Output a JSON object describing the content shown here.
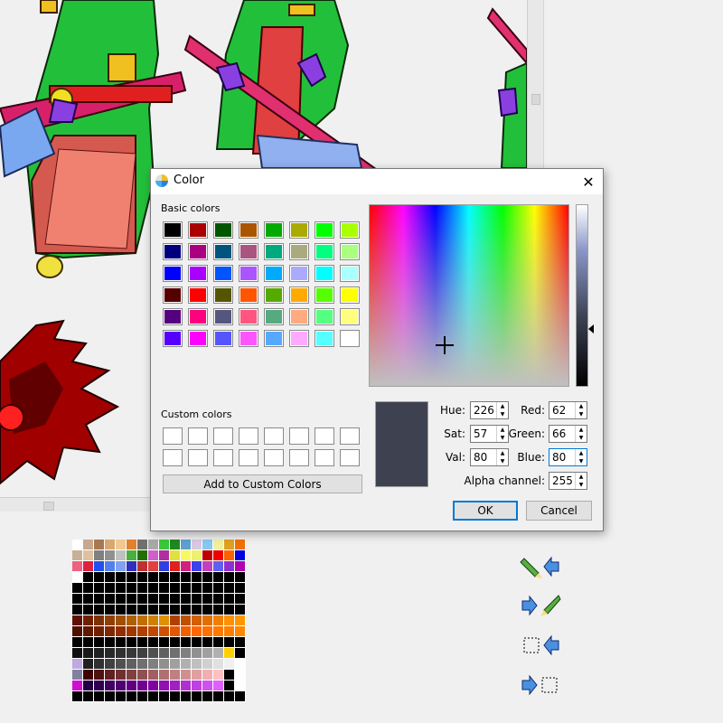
{
  "dialog": {
    "title": "Color",
    "close_glyph": "✕",
    "basic_colors_label": "Basic colors",
    "custom_colors_label": "Custom colors",
    "add_custom_label": "Add to Custom Colors",
    "ok_label": "OK",
    "cancel_label": "Cancel",
    "basic_colors": [
      "#000000",
      "#aa0000",
      "#005500",
      "#aa5500",
      "#00aa00",
      "#aaaa00",
      "#00ff00",
      "#aaff00",
      "#00007f",
      "#aa007f",
      "#00557f",
      "#aa557f",
      "#00aa7f",
      "#aaaa7f",
      "#00ff7f",
      "#aaff7f",
      "#0000ff",
      "#aa00ff",
      "#0055ff",
      "#aa55ff",
      "#00aaff",
      "#aaaaff",
      "#00ffff",
      "#aaffff",
      "#550000",
      "#ff0000",
      "#555500",
      "#ff5500",
      "#55aa00",
      "#ffaa00",
      "#55ff00",
      "#ffff00",
      "#55007f",
      "#ff007f",
      "#55557f",
      "#ff557f",
      "#55aa7f",
      "#ffaa7f",
      "#55ff7f",
      "#ffff7f",
      "#5500ff",
      "#ff00ff",
      "#5555ff",
      "#ff55ff",
      "#55aaff",
      "#ffaaff",
      "#55ffff",
      "#ffffff"
    ],
    "custom_colors_count": 16,
    "current_color": "#3e4250",
    "fields": {
      "hue_label": "Hue:",
      "hue": "226",
      "sat_label": "Sat:",
      "sat": "57",
      "val_label": "Val:",
      "val": "80",
      "red_label": "Red:",
      "red": "62",
      "green_label": "Green:",
      "green": "66",
      "blue_label": "Blue:",
      "blue": "80",
      "alpha_label": "Alpha channel:",
      "alpha": "255"
    }
  },
  "palette": {
    "columns": 16,
    "colors": [
      "#ffffff",
      "#c8a890",
      "#a87850",
      "#d8a870",
      "#f0c890",
      "#e08030",
      "#707070",
      "#a8a8a8",
      "#38c838",
      "#208820",
      "#60a0d0",
      "#d8c8e0",
      "#88c8f0",
      "#f0f0a0",
      "#e0a020",
      "#f07000",
      "#c8b098",
      "#e0c0a0",
      "#808080",
      "#909090",
      "#c0c0c0",
      "#48b040",
      "#207000",
      "#d060c8",
      "#b030a0",
      "#e0e040",
      "#f8f860",
      "#f0f070",
      "#c00000",
      "#f00000",
      "#ff6000",
      "#0000e0",
      "#f06080",
      "#e02040",
      "#2050f0",
      "#5080f0",
      "#80a0f0",
      "#3030c0",
      "#c03030",
      "#e04040",
      "#3040e0",
      "#e02020",
      "#d02080",
      "#4040f0",
      "#c040c0",
      "#6060f0",
      "#9030d0",
      "#b000b0",
      "#ffffff",
      "#000000",
      "#000000",
      "#000000",
      "#000000",
      "#000000",
      "#000000",
      "#000000",
      "#000000",
      "#000000",
      "#000000",
      "#000000",
      "#000000",
      "#000000",
      "#000000",
      "#000000",
      "#000000",
      "#000000",
      "#000000",
      "#000000",
      "#000000",
      "#000000",
      "#000000",
      "#000000",
      "#000000",
      "#000000",
      "#000000",
      "#000000",
      "#000000",
      "#000000",
      "#000000",
      "#000000",
      "#000000",
      "#000000",
      "#000000",
      "#000000",
      "#000000",
      "#000000",
      "#000000",
      "#000000",
      "#000000",
      "#000000",
      "#000000",
      "#000000",
      "#000000",
      "#000000",
      "#000000",
      "#000000",
      "#000000",
      "#000000",
      "#000000",
      "#000000",
      "#000000",
      "#000000",
      "#000000",
      "#000000",
      "#000000",
      "#000000",
      "#000000",
      "#000000",
      "#000000",
      "#000000",
      "#000000",
      "#000000",
      "#601000",
      "#702000",
      "#803000",
      "#904000",
      "#a05000",
      "#b06000",
      "#c07000",
      "#d08000",
      "#e09000",
      "#b04000",
      "#c05000",
      "#d06000",
      "#e07000",
      "#f08000",
      "#ff9000",
      "#ff9800",
      "#501000",
      "#601800",
      "#702000",
      "#802800",
      "#903000",
      "#a03800",
      "#b04000",
      "#c04800",
      "#d05000",
      "#e05800",
      "#f06000",
      "#ff6800",
      "#ff7000",
      "#ff7800",
      "#ff8000",
      "#ff8800",
      "#000000",
      "#000000",
      "#000000",
      "#000000",
      "#000000",
      "#000000",
      "#000000",
      "#000000",
      "#000000",
      "#000000",
      "#000000",
      "#000000",
      "#000000",
      "#000000",
      "#000000",
      "#000000",
      "#101010",
      "#181818",
      "#202020",
      "#282828",
      "#303030",
      "#383838",
      "#404040",
      "#505050",
      "#606060",
      "#707070",
      "#808080",
      "#909090",
      "#a0a0a0",
      "#b0b0b0",
      "#ffd000",
      "#000000",
      "#c0a8e0",
      "#202020",
      "#303030",
      "#404040",
      "#505050",
      "#606060",
      "#707070",
      "#808080",
      "#909090",
      "#a0a0a0",
      "#b0b0b0",
      "#c0c0c0",
      "#d0d0d0",
      "#e0e0e0",
      "#f0f0f0",
      "#ffffff",
      "#8080a0",
      "#400000",
      "#501010",
      "#602020",
      "#703030",
      "#804040",
      "#905050",
      "#a06060",
      "#b07070",
      "#c08080",
      "#d09090",
      "#e0a0a0",
      "#f0b0b0",
      "#ffc0c0",
      "#000000",
      "#ffffff",
      "#d010d0",
      "#200040",
      "#300050",
      "#400060",
      "#500070",
      "#600080",
      "#700090",
      "#8000a0",
      "#9010b0",
      "#a020c0",
      "#b030d0",
      "#c040e0",
      "#d050f0",
      "#e060ff",
      "#000000",
      "#ffffff",
      "#000000",
      "#000000",
      "#000000",
      "#000000",
      "#000000",
      "#000000",
      "#000000",
      "#000000",
      "#000000",
      "#000000",
      "#000000",
      "#000000",
      "#000000",
      "#000000",
      "#000000",
      "#000000"
    ]
  }
}
